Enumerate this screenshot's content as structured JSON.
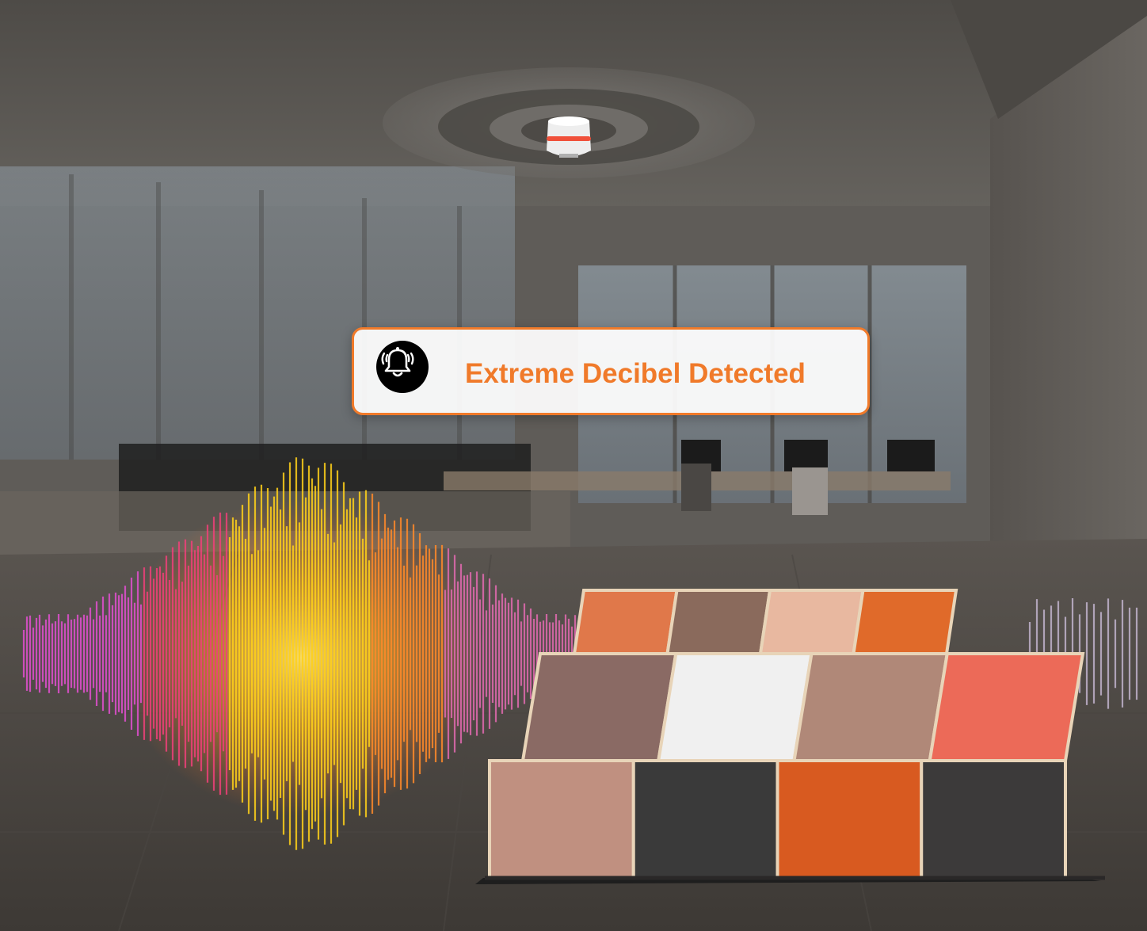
{
  "alert": {
    "message": "Extreme Decibel Detected",
    "icon": "alarm-bell-icon",
    "accent_color": "#f07a2a"
  },
  "scene": {
    "device": "smoke-alarm-icon",
    "floor_tiles": [
      {
        "row": 0,
        "color": "#e0784a"
      },
      {
        "row": 0,
        "color": "#8a6a5c"
      },
      {
        "row": 0,
        "color": "#e8b8a0"
      },
      {
        "row": 0,
        "color": "#e06a2a"
      },
      {
        "row": 1,
        "color": "#8a6a64"
      },
      {
        "row": 1,
        "color": "#f0f0f0"
      },
      {
        "row": 1,
        "color": "#b08878"
      },
      {
        "row": 1,
        "color": "#ec6a58"
      },
      {
        "row": 2,
        "color": "#c09080"
      },
      {
        "row": 2,
        "color": "#3a3a3a"
      },
      {
        "row": 2,
        "color": "#d85a20"
      },
      {
        "row": 2,
        "color": "#3c3a3a"
      }
    ]
  }
}
